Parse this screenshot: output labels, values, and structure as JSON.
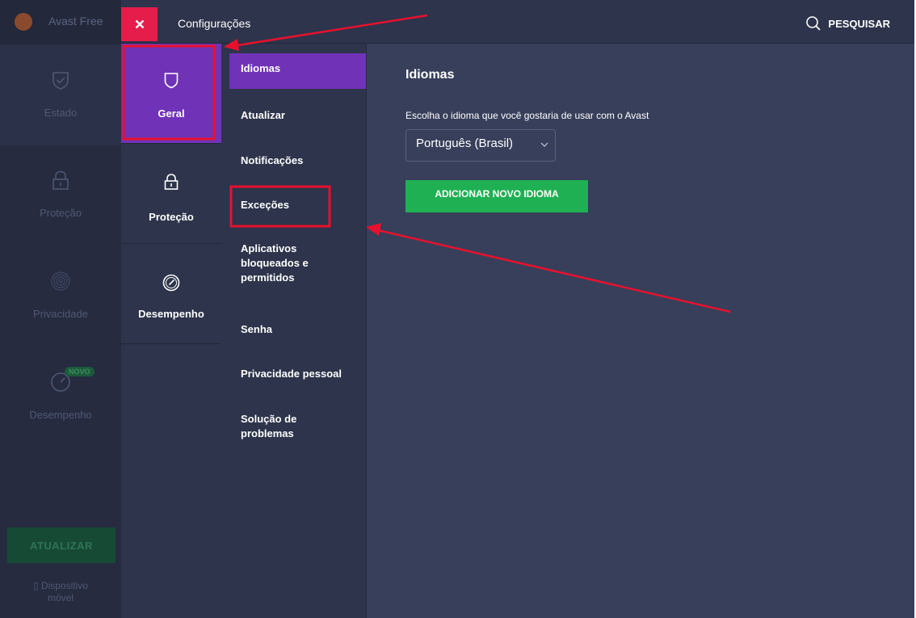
{
  "background_app": {
    "title": "Avast Free",
    "nav": [
      {
        "label": "Estado",
        "icon": "shield-check-icon"
      },
      {
        "label": "Proteção",
        "icon": "lock-icon"
      },
      {
        "label": "Privacidade",
        "icon": "fingerprint-icon"
      },
      {
        "label": "Desempenho",
        "icon": "speedometer-icon"
      }
    ],
    "new_badge": "NOVO",
    "update_button": "ATUALIZAR",
    "mobile_line1": "Dispositivo",
    "mobile_line2": "móvel"
  },
  "settings": {
    "title": "Configurações",
    "search_label": "PESQUISAR",
    "categories": [
      {
        "label": "Geral",
        "icon": "shield-icon",
        "active": true
      },
      {
        "label": "Proteção",
        "icon": "lock-icon",
        "active": false
      },
      {
        "label": "Desempenho",
        "icon": "speedometer-icon",
        "active": false
      }
    ],
    "submenu": [
      {
        "label": "Idiomas",
        "active": true
      },
      {
        "label": "Atualizar"
      },
      {
        "label": "Notificações"
      },
      {
        "label": "Exceções"
      },
      {
        "label": "Aplicativos bloqueados e permitidos"
      },
      {
        "label": "Senha"
      },
      {
        "label": "Privacidade pessoal"
      },
      {
        "label": "Solução de problemas"
      }
    ]
  },
  "content": {
    "heading": "Idiomas",
    "description": "Escolha o idioma que você gostaria de usar com o Avast",
    "selected_language": "Português (Brasil)",
    "add_button": "ADICIONAR NOVO IDIOMA"
  },
  "colors": {
    "accent_purple": "#7033b8",
    "close_red": "#e51d4b",
    "action_green": "#1fb053",
    "annotation_red": "#e8112d",
    "panel_dark": "#2d344b",
    "content_bg": "#373f5a"
  }
}
